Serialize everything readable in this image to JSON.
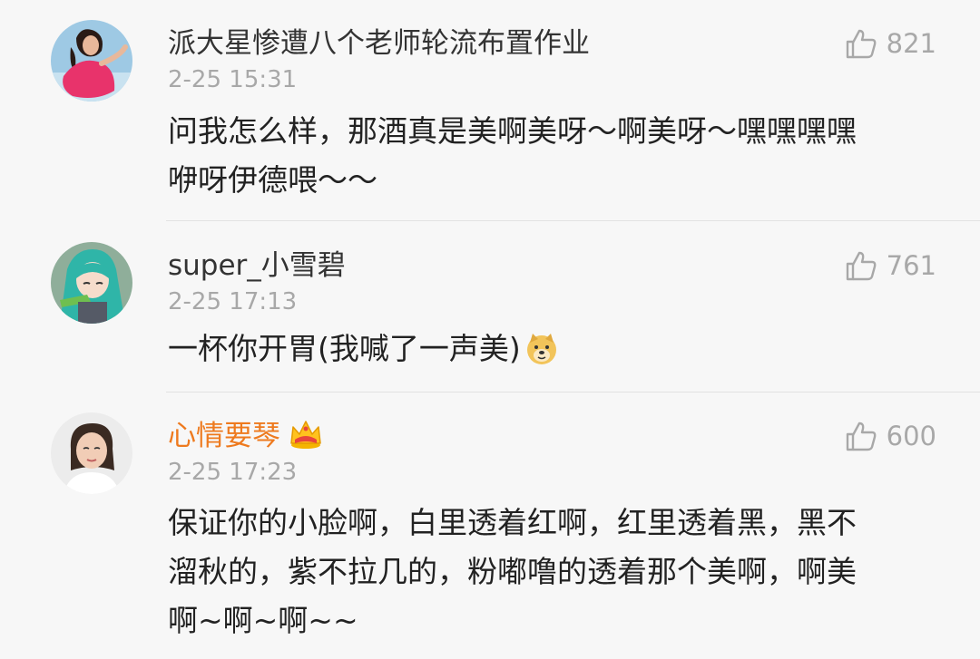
{
  "comments": [
    {
      "username": "派大星惨遭八个老师轮流布置作业",
      "timestamp": "2-25 15:31",
      "likes": "821",
      "lines": [
        "问我怎么样，那酒真是美啊美呀～啊美呀～嘿嘿嘿嘿",
        "咿呀伊德喂～～"
      ],
      "avatar_icon": "avatar-woman-pink-dress"
    },
    {
      "username": "super_小雪碧",
      "timestamp": "2-25 17:13",
      "likes": "761",
      "lines": [
        "一杯你开胃(我喊了一声美)"
      ],
      "emoji_icon": "doge-emoji",
      "avatar_icon": "avatar-anime-teal-hair"
    },
    {
      "username": "心情要琴",
      "timestamp": "2-25 17:23",
      "likes": "600",
      "lines": [
        "保证你的小脸啊，白里透着红啊，红里透着黑，黑不",
        "溜秋的，紫不拉几的，粉嘟噜的透着那个美啊，啊美",
        "啊~啊~啊~~"
      ],
      "badge_icon": "crown-icon",
      "avatar_icon": "avatar-woman-selfie"
    }
  ],
  "colors": {
    "background": "#f7f7f7",
    "username": "#333333",
    "vip_username": "#ee7a1e",
    "meta": "#a8a8a8",
    "body": "#222222",
    "divider": "#e2e2e2"
  }
}
